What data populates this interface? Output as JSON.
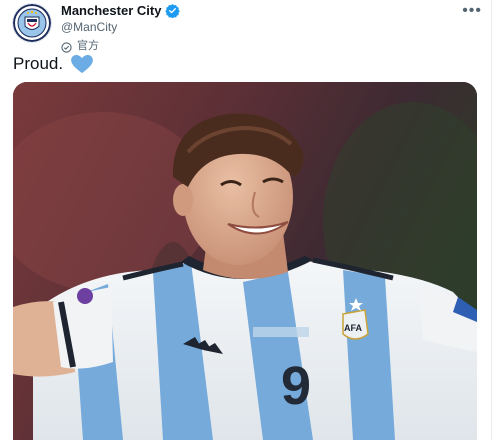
{
  "tweet": {
    "display_name": "Manchester City",
    "handle": "@ManCity",
    "official_label": "官方",
    "text": "Proud.",
    "more_label": "•••",
    "avatar_icon": "manchester-city-crest",
    "verified_icon": "verified-badge-icon",
    "heart_icon": "blue-heart-emoji",
    "colors": {
      "verified": "#1d9bf0",
      "heart": "#6cace4",
      "sky_blue": "#75aadb"
    }
  },
  "media": {
    "subject": "player-in-argentina-jersey",
    "jersey_number": "9",
    "crest_text": "AFA"
  }
}
